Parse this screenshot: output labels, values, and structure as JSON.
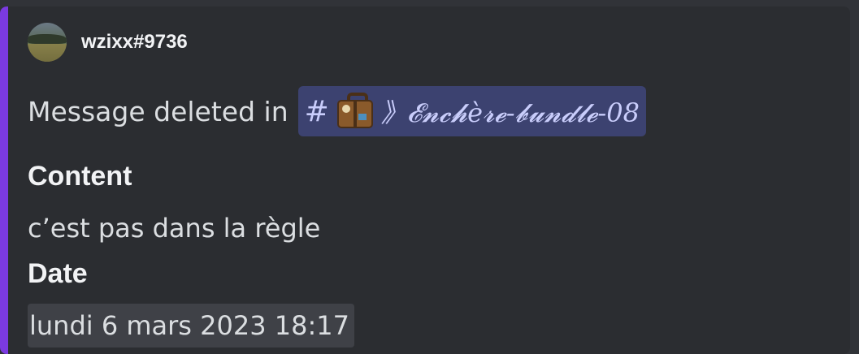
{
  "author": {
    "name": "wzixx#9736",
    "avatar_icon": "landscape-avatar"
  },
  "description": {
    "prefix": "Message deleted in",
    "channel": {
      "hash": "#",
      "emoji_icon": "luggage-icon",
      "name": "》𝓔𝓷𝓬𝓱è𝓻𝓮-𝓫𝓾𝓷𝓭𝓵𝓮-08"
    }
  },
  "fields": {
    "content": {
      "name": "Content",
      "value": "c’est pas dans la règle"
    },
    "date": {
      "name": "Date",
      "value": "lundi 6 mars 2023 18:17"
    }
  },
  "colors": {
    "accent": "#7b3ae0",
    "embed_bg": "#2b2d31",
    "mention_bg": "#3c4270",
    "mention_text": "#c9cdfb"
  }
}
